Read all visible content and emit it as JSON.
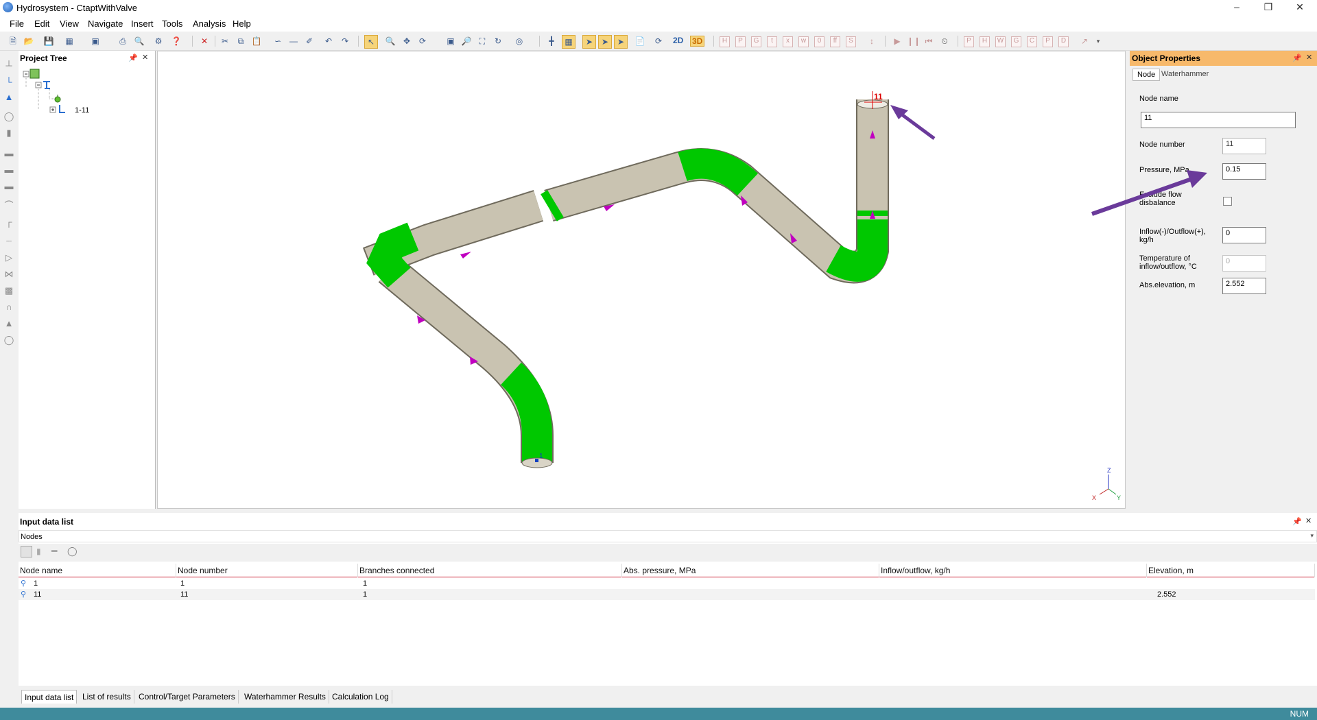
{
  "window": {
    "title": "Hydrosystem - CtaptWithValve"
  },
  "menu": [
    "File",
    "Edit",
    "View",
    "Navigate",
    "Insert",
    "Tools",
    "Analysis",
    "Help"
  ],
  "toolbar": {
    "view_2d": "2D",
    "view_3d": "3D"
  },
  "project_tree": {
    "title": "Project Tree",
    "items": [
      {
        "label": "1-11"
      }
    ]
  },
  "viewport": {
    "node_labels": {
      "end_node": "11",
      "start_node": "1"
    },
    "axes": {
      "z": "Z",
      "x": "X",
      "y": "Y"
    },
    "colors": {
      "pipe": "#c9c3b1",
      "elbow": "#00c800",
      "flow_arrow": "#c000c0",
      "annotation_arrow": "#6a3a9a"
    }
  },
  "properties": {
    "title": "Object Properties",
    "tabs": [
      "Node",
      "Waterhammer"
    ],
    "node_name_label": "Node name",
    "node_name_value": "11",
    "node_number_label": "Node number",
    "node_number_value": "11",
    "pressure_label": "Pressure,  MPa",
    "pressure_value": "0.15",
    "disbalance_label": "Exclude flow disbalance",
    "disbalance_checked": false,
    "inflow_label": "Inflow(-)/Outflow(+), kg/h",
    "inflow_value": "0",
    "temperature_label": "Temperature of inflow/outflow,  °C",
    "temperature_value": "0",
    "elevation_label": "Abs.elevation,  m",
    "elevation_value": "2.552"
  },
  "input_list": {
    "title": "Input data list",
    "selector": "Nodes",
    "columns": [
      "Node name",
      "Node number",
      "Branches connected",
      "Abs. pressure, MPa",
      "Inflow/outflow, kg/h",
      "Elevation, m"
    ],
    "rows": [
      [
        "1",
        "1",
        "1",
        "",
        "",
        ""
      ],
      [
        "11",
        "11",
        "1",
        "",
        "",
        "2.552"
      ]
    ]
  },
  "bottom_tabs": [
    "Input data list",
    "List of results",
    "Control/Target Parameters",
    "Waterhammer Results",
    "Calculation Log"
  ],
  "status": {
    "num": "NUM"
  }
}
